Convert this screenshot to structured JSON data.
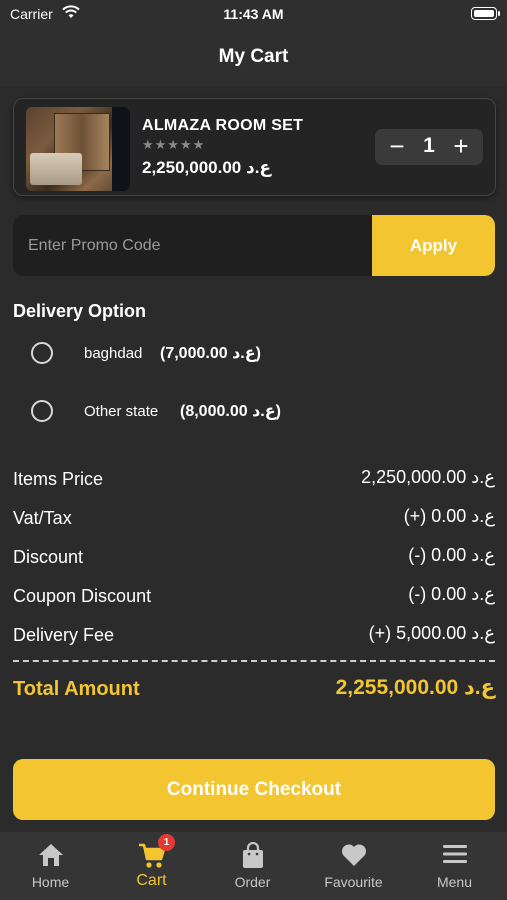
{
  "status_bar": {
    "carrier": "Carrier",
    "time": "11:43 AM"
  },
  "header": {
    "title": "My Cart"
  },
  "cart_item": {
    "name": "ALMAZA ROOM SET",
    "stars": "★★★★★",
    "rating": 0,
    "price": "2,250,000.00 ع.د",
    "quantity": "1",
    "minus": "−",
    "plus": "+"
  },
  "promo": {
    "placeholder": "Enter Promo Code",
    "value": "",
    "apply_label": "Apply"
  },
  "delivery": {
    "title": "Delivery Option",
    "options": [
      {
        "label": "baghdad",
        "fee": "(7,000.00 ع.د)",
        "selected": false
      },
      {
        "label": "Other state",
        "fee": "(8,000.00 ع.د)",
        "selected": false
      }
    ]
  },
  "summary": {
    "items_price": {
      "label": "Items Price",
      "value": "2,250,000.00 ع.د"
    },
    "vat": {
      "label": "Vat/Tax",
      "value": "(+) 0.00 ع.د"
    },
    "discount": {
      "label": "Discount",
      "value": "(-) 0.00 ع.د"
    },
    "coupon": {
      "label": "Coupon Discount",
      "value": "(-) 0.00 ع.د"
    },
    "delivery_fee": {
      "label": "Delivery Fee",
      "value": "(+) 5,000.00 ع.د"
    },
    "total": {
      "label": "Total Amount",
      "value": "2,255,000.00 ع.د"
    }
  },
  "checkout_label": "Continue Checkout",
  "tabbar": {
    "home": "Home",
    "cart": "Cart",
    "cart_badge": "1",
    "order": "Order",
    "favourite": "Favourite",
    "menu": "Menu"
  },
  "colors": {
    "accent": "#f2c531",
    "background": "#2b2b2b",
    "badge": "#e53935"
  }
}
